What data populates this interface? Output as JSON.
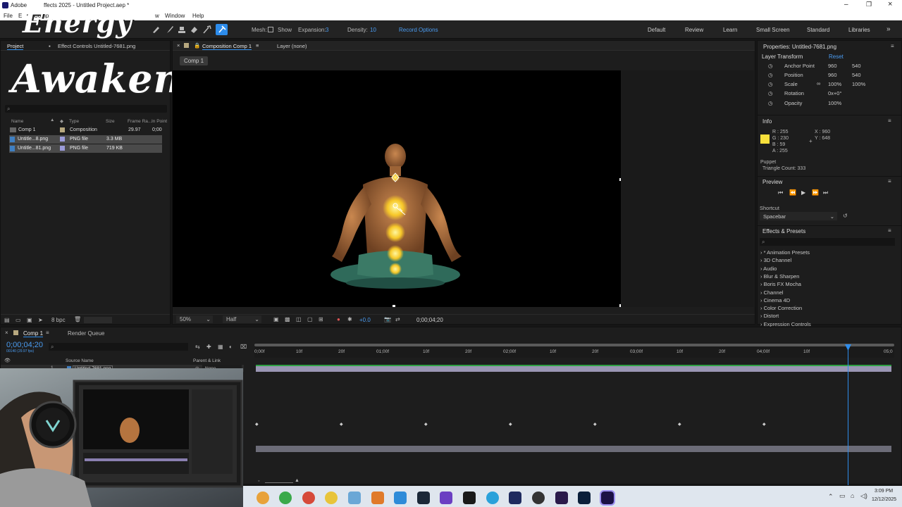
{
  "window": {
    "title": "Adobe After Effects 2025 - Untitled Project.aep *",
    "app_short": "Adobe",
    "title_fragment": "ffects 2025 - Untitled Project.aep *"
  },
  "menu": {
    "items": [
      "File",
      "E",
      "Comp",
      "w",
      "Window",
      "Help"
    ]
  },
  "overlay": {
    "line1": "Energy",
    "line2": "Awakening"
  },
  "toolbar": {
    "mesh_label": "Mesh:",
    "show_label": "Show",
    "expansion_label": "Expansion:",
    "expansion_value": "3",
    "density_label": "Density:",
    "density_value": "10",
    "record_options": "Record Options"
  },
  "workspaces": [
    "Default",
    "Review",
    "Learn",
    "Small Screen",
    "Standard",
    "Libraries"
  ],
  "project": {
    "tab_project": "Project",
    "tab_effect_controls": "Effect Controls Untitled-7681.png",
    "columns": [
      "Name",
      "Type",
      "Size",
      "Frame Ra...",
      "In Point"
    ],
    "rows": [
      {
        "name": "Comp 1",
        "type": "Composition",
        "size": "",
        "fps": "29.97",
        "in": "0;00"
      },
      {
        "name": "Untitle...8.png",
        "type": "PNG file",
        "size": "3.3 MB",
        "fps": "",
        "in": ""
      },
      {
        "name": "Untitle...81.png",
        "type": "PNG file",
        "size": "719 KB",
        "fps": "",
        "in": ""
      }
    ],
    "bpc": "8 bpc"
  },
  "composition": {
    "tab": "Composition Comp 1",
    "layer_tab": "Layer (none)",
    "breadcrumb": "Comp 1",
    "zoom": "50%",
    "resolution": "Half",
    "exposure": "+0.0",
    "timecode": "0;00;04;20"
  },
  "properties": {
    "title": "Properties: Untitled-7681.png",
    "section": "Layer Transform",
    "reset": "Reset",
    "rows": [
      {
        "label": "Anchor Point",
        "v1": "960",
        "v2": "540"
      },
      {
        "label": "Position",
        "v1": "960",
        "v2": "540"
      },
      {
        "label": "Scale",
        "v1": "100%",
        "v2": "100%"
      },
      {
        "label": "Rotation",
        "v1": "0x+0°",
        "v2": ""
      },
      {
        "label": "Opacity",
        "v1": "100%",
        "v2": ""
      }
    ]
  },
  "info": {
    "title": "Info",
    "r": "R : 255",
    "g": "G : 230",
    "b": "B : 59",
    "a": "A : 255",
    "x": "X : 960",
    "y": "Y : 648",
    "swatch": "#f7e03b",
    "puppet": "Puppet",
    "triangles": "Triangle Count: 333"
  },
  "preview": {
    "title": "Preview",
    "shortcut_label": "Shortcut",
    "shortcut_value": "Spacebar"
  },
  "effects": {
    "title": "Effects & Presets",
    "items": [
      "* Animation Presets",
      "3D Channel",
      "Audio",
      "Blur & Sharpen",
      "Boris FX Mocha",
      "Channel",
      "Cinema 4D",
      "Color Correction",
      "Distort",
      "Expression Controls"
    ]
  },
  "timeline": {
    "tab": "Comp 1",
    "render_queue": "Render Queue",
    "timecode": "0;00;04;20",
    "fps": "00140 (29.97 fps)",
    "source_name_header": "Source Name",
    "parent_header": "Parent & Link",
    "layer_num": "1",
    "layer_name": "Untitled-7681.png",
    "parent_value": "None",
    "ruler": [
      "0;00f",
      "10f",
      "20f",
      "01;00f",
      "10f",
      "20f",
      "02;00f",
      "10f",
      "20f",
      "03;00f",
      "10f",
      "20f",
      "04;00f",
      "10f",
      "05;0"
    ]
  },
  "taskbar": {
    "time": "3:09 PM",
    "date": "12/12/2025"
  },
  "colors": {
    "accent": "#2d8ceb",
    "panel": "#1d1d1d",
    "bg": "#161616",
    "green": "#2ea043"
  }
}
